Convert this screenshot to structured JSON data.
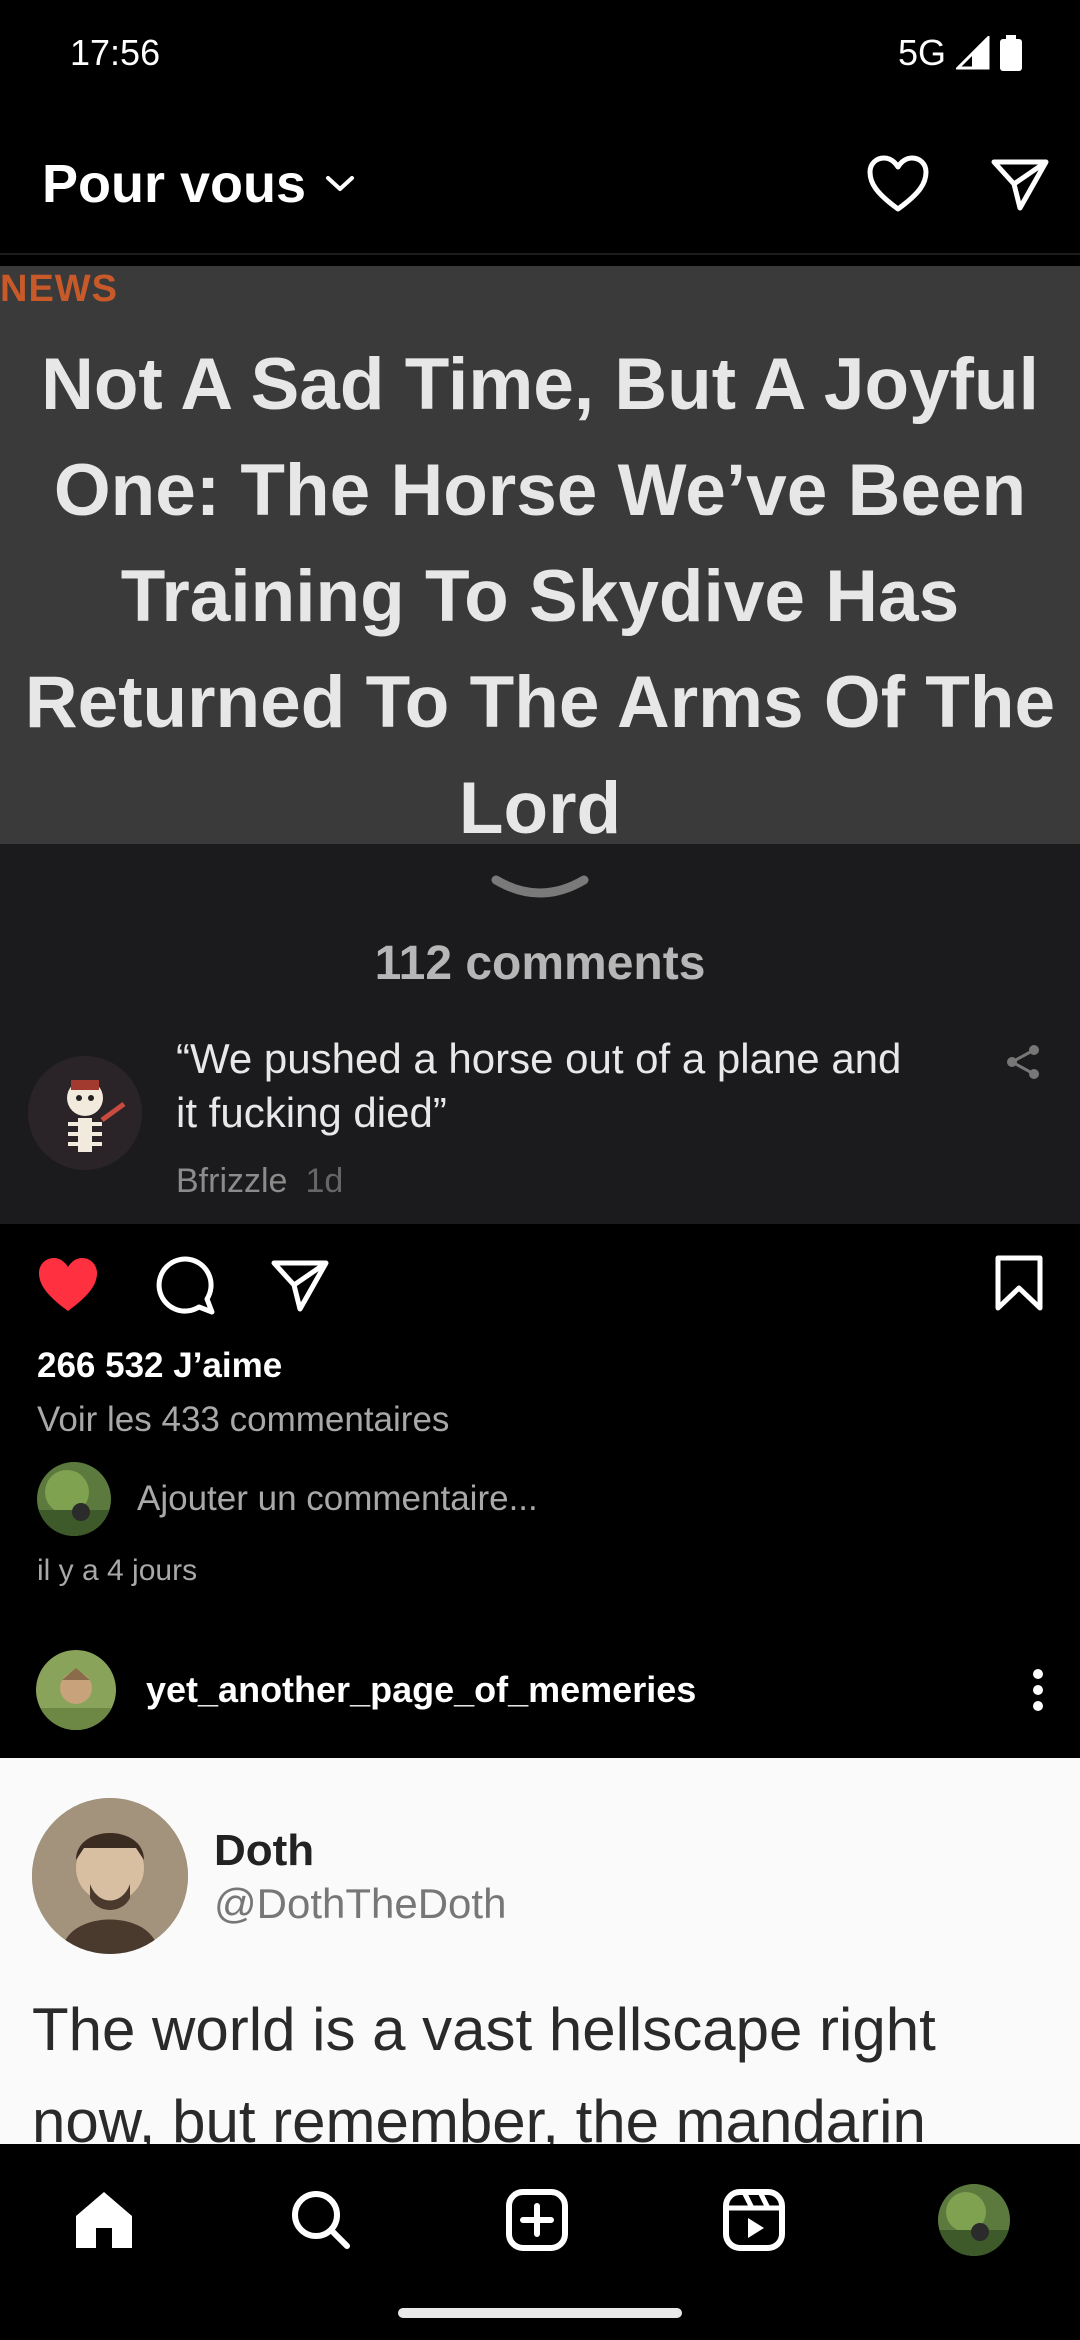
{
  "status_bar": {
    "time": "17:56",
    "network": "5G"
  },
  "header": {
    "title": "Pour vous"
  },
  "post": {
    "news_tag": "NEWS",
    "headline": "Not A Sad Time, But A Joyful One: The Horse We’ve Been Training To Skydive Has Returned To The Arms Of The Lord",
    "comments_count": "112 comments",
    "comment": {
      "text": "“We pushed a horse out of a plane and it fucking died”",
      "author": "Bfrizzle",
      "time": "1d"
    },
    "likes": "266 532 J’aime",
    "view_comments": "Voir les 433 commentaires",
    "add_comment_placeholder": "Ajouter un commentaire...",
    "age": "il y a 4 jours",
    "liked": true
  },
  "next_post": {
    "username": "yet_another_page_of_memeries",
    "tweet": {
      "name": "Doth",
      "handle": "@DothTheDoth",
      "text": "The world is a vast hellscape right now, but remember, the mandarin"
    }
  },
  "colors": {
    "like_red": "#ff3040",
    "news_orange": "#c85a2a",
    "banner_bg": "#3a3a3a",
    "sheet_bg": "#1b1b1d"
  },
  "icons": {
    "header": [
      "heart-outline-icon",
      "send-icon"
    ],
    "actions": [
      "heart-filled-icon",
      "comment-icon",
      "send-icon",
      "bookmark-icon"
    ],
    "nav": [
      "home-icon",
      "search-icon",
      "create-icon",
      "reels-icon",
      "profile-avatar"
    ]
  }
}
